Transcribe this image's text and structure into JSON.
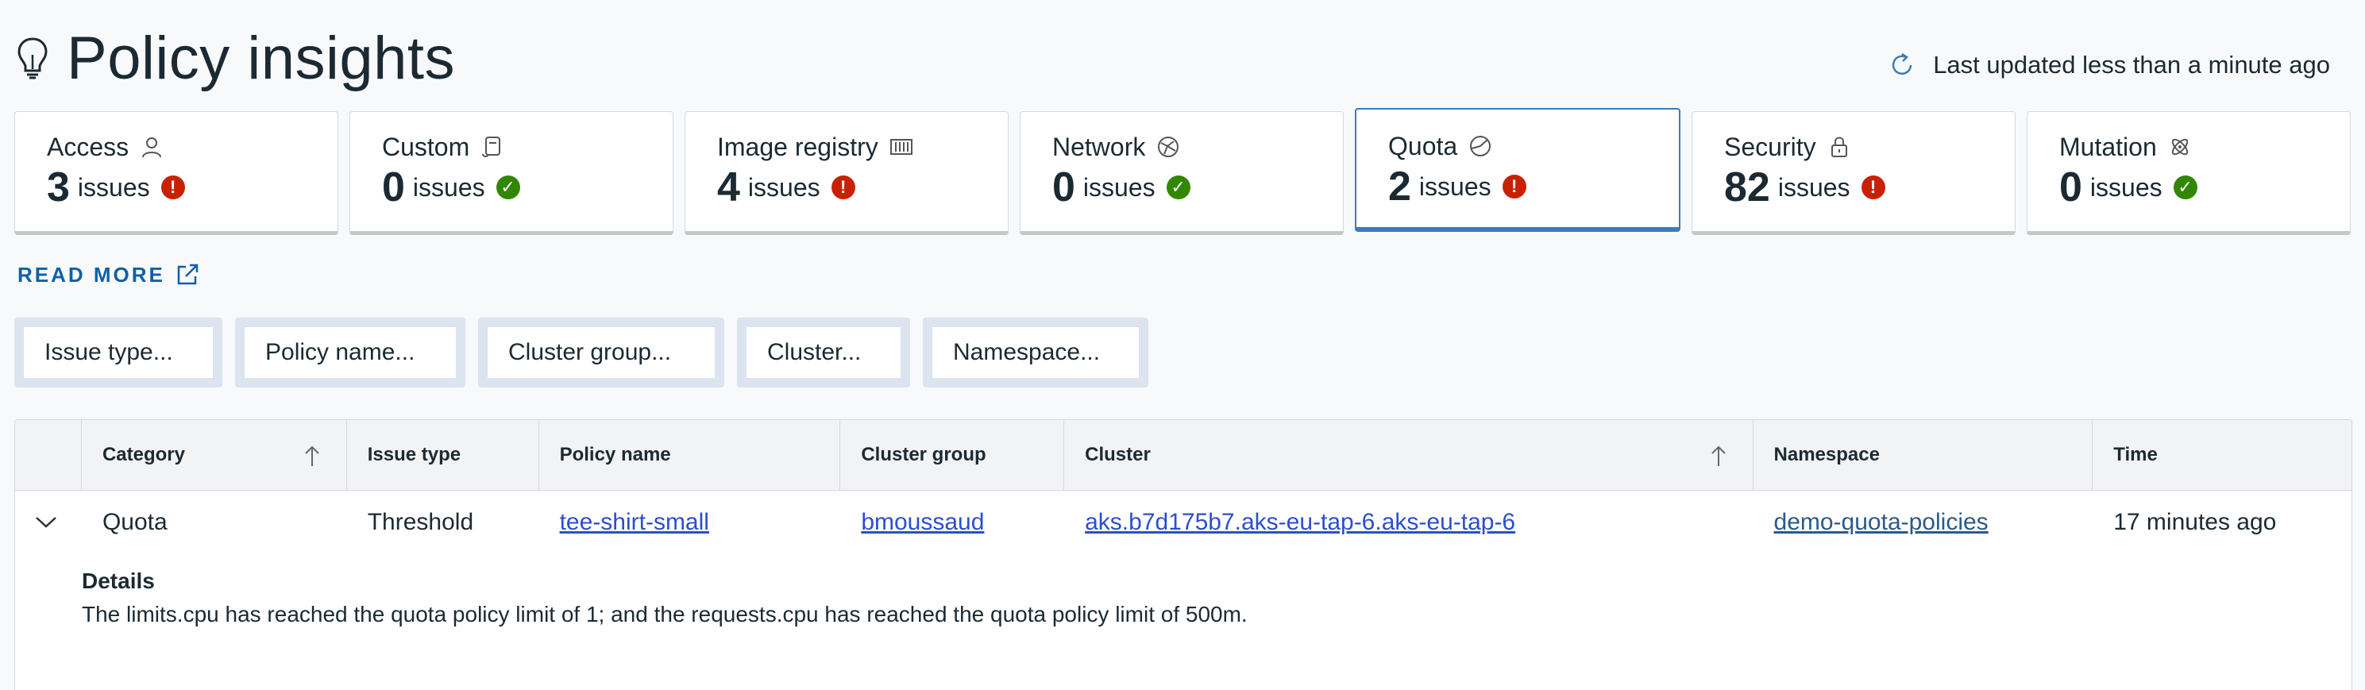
{
  "header": {
    "title": "Policy insights",
    "last_updated": "Last updated less than a minute ago"
  },
  "cards": [
    {
      "title": "Access",
      "count": "3",
      "unit": "issues",
      "status": "error",
      "icon": "user-icon"
    },
    {
      "title": "Custom",
      "count": "0",
      "unit": "issues",
      "status": "ok",
      "icon": "scroll-icon"
    },
    {
      "title": "Image registry",
      "count": "4",
      "unit": "issues",
      "status": "error",
      "icon": "registry-icon"
    },
    {
      "title": "Network",
      "count": "0",
      "unit": "issues",
      "status": "ok",
      "icon": "network-icon"
    },
    {
      "title": "Quota",
      "count": "2",
      "unit": "issues",
      "status": "error",
      "icon": "quota-icon",
      "selected": true
    },
    {
      "title": "Security",
      "count": "82",
      "unit": "issues",
      "status": "error",
      "icon": "lock-icon"
    },
    {
      "title": "Mutation",
      "count": "0",
      "unit": "issues",
      "status": "ok",
      "icon": "mutation-icon"
    }
  ],
  "read_more": "READ MORE",
  "filters": [
    "Issue type...",
    "Policy name...",
    "Cluster group...",
    "Cluster...",
    "Namespace..."
  ],
  "table": {
    "columns": [
      "Category",
      "Issue type",
      "Policy name",
      "Cluster group",
      "Cluster",
      "Namespace",
      "Time"
    ],
    "rows": [
      {
        "category": "Quota",
        "issue_type": "Threshold",
        "policy_name": "tee-shirt-small",
        "cluster_group": "bmoussaud",
        "cluster": "aks.b7d175b7.aks-eu-tap-6.aks-eu-tap-6",
        "namespace": "demo-quota-policies",
        "time": "17 minutes ago",
        "details_label": "Details",
        "details": "The limits.cpu has reached the quota policy limit of 1; and the requests.cpu has reached the quota policy limit of 500m."
      }
    ]
  },
  "colors": {
    "accent": "#3b7cb5",
    "error": "#c92100",
    "ok": "#318700",
    "link": "#2d4ecf"
  }
}
